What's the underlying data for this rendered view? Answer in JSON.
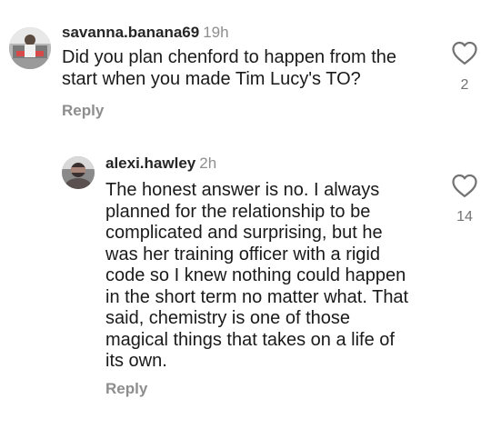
{
  "comments": [
    {
      "username": "savanna.banana69",
      "time": "19h",
      "text": "Did you plan chenford to happen from the\nstart when you made Tim Lucy's TO?",
      "reply_label": "Reply",
      "like_count": "2",
      "avatar_icon": "user-photo-avatar",
      "like_icon": "heart-outline-icon"
    },
    {
      "username": "alexi.hawley",
      "time": "2h",
      "text": "The honest answer is no. I always\nplanned for the relationship to be\ncomplicated and surprising, but he\nwas her training officer with a rigid\ncode so I knew nothing could happen\nin the short term no matter what. That\nsaid, chemistry is one of those\nmagical things that takes on a life of\nits own.",
      "reply_label": "Reply",
      "like_count": "14",
      "avatar_icon": "user-photo-avatar",
      "like_icon": "heart-outline-icon"
    }
  ],
  "colors": {
    "text": "#1a1a1a",
    "secondary": "#8e8e8e",
    "background": "#ffffff"
  }
}
